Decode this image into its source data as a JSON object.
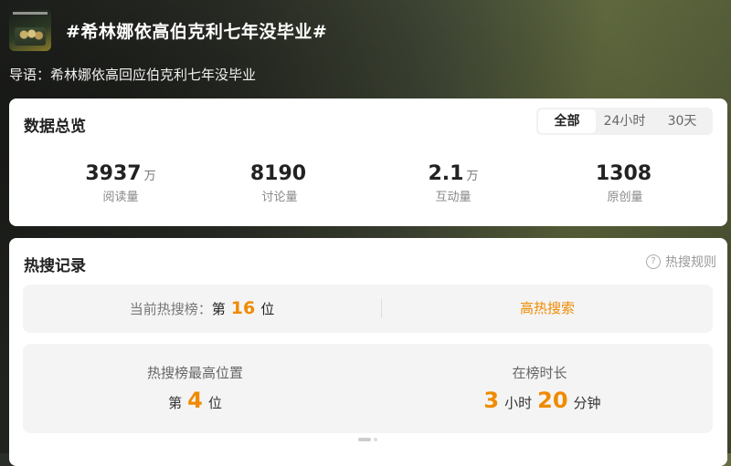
{
  "topic": {
    "title": "#希林娜依高伯克利七年没毕业#",
    "lead": "导语：希林娜依高回应伯克利七年没毕业"
  },
  "overview": {
    "title": "数据总览",
    "tabs": [
      "全部",
      "24小时",
      "30天"
    ],
    "active_tab": "全部",
    "stats": [
      {
        "value": "3937",
        "unit": "万",
        "label": "阅读量"
      },
      {
        "value": "8190",
        "unit": "",
        "label": "讨论量"
      },
      {
        "value": "2.1",
        "unit": "万",
        "label": "互动量"
      },
      {
        "value": "1308",
        "unit": "",
        "label": "原创量"
      }
    ]
  },
  "hot": {
    "title": "热搜记录",
    "rules_label": "热搜规则",
    "current_prefix": "当前热搜榜：",
    "current_di": "第",
    "current_rank": "16",
    "current_wei": "位",
    "hot_link": "高热搜索",
    "best_label": "热搜榜最高位置",
    "best_di": "第",
    "best_rank": "4",
    "best_wei": "位",
    "duration_label": "在榜时长",
    "duration_hours": "3",
    "hours_unit": "小时",
    "duration_minutes": "20",
    "minutes_unit": "分钟"
  },
  "colors": {
    "accent": "#f08a00",
    "card_bg": "#ffffff",
    "panel_bg": "#f4f4f4"
  }
}
